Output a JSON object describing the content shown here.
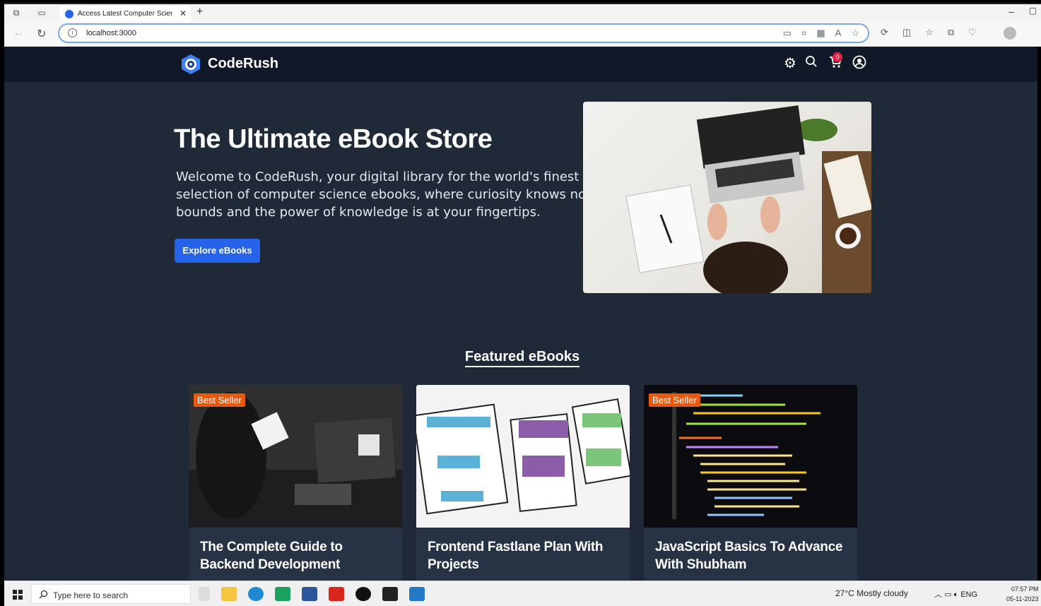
{
  "browser": {
    "tab_title": "Access Latest Computer Science",
    "url": "localhost:3000"
  },
  "site": {
    "brand": "CodeRush",
    "cart_count": "0",
    "icons": [
      "gear-icon",
      "search-icon",
      "cart-icon",
      "user-icon"
    ]
  },
  "hero": {
    "title": "The Ultimate eBook Store",
    "text": "Welcome to CodeRush, your digital library for the world's finest selection of computer science ebooks, where curiosity knows no bounds and the power of knowledge is at your fingertips.",
    "cta": "Explore eBooks"
  },
  "featured": {
    "heading": "Featured eBooks",
    "cards": [
      {
        "badge": "Best Seller",
        "title": "The Complete Guide to Backend Development"
      },
      {
        "badge": "",
        "title": "Frontend Fastlane Plan With Projects"
      },
      {
        "badge": "Best Seller",
        "title": "JavaScript Basics To Advance With Shubham"
      }
    ]
  },
  "taskbar": {
    "search_placeholder": "Type here to search",
    "weather": "27°C  Mostly cloudy",
    "language": "ENG",
    "time": "07:57 PM",
    "date": "05-11-2023"
  },
  "colors": {
    "page_bg": "#1f2937",
    "navbar_bg": "#111827",
    "accent": "#2563eb",
    "badge": "#ea580c"
  }
}
